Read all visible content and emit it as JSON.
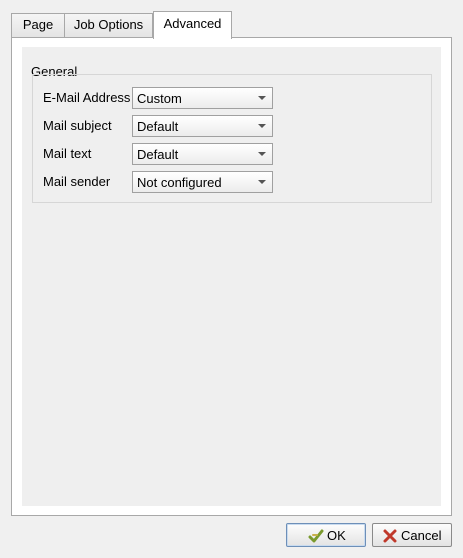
{
  "tabs": [
    {
      "label": "Page",
      "active": false
    },
    {
      "label": "Job Options",
      "active": false
    },
    {
      "label": "Advanced",
      "active": true
    }
  ],
  "group": {
    "title": "General",
    "rows": [
      {
        "label": "E-Mail Address",
        "value": "Custom"
      },
      {
        "label": "Mail subject",
        "value": "Default"
      },
      {
        "label": "Mail text",
        "value": "Default"
      },
      {
        "label": "Mail sender",
        "value": "Not configured"
      }
    ]
  },
  "buttons": {
    "ok_label": "OK",
    "ok_icon": "checkmark-arrow-icon",
    "cancel_label": "Cancel",
    "cancel_icon": "cross-icon"
  },
  "colors": {
    "ok_icon": "#7a9a2e",
    "cancel_icon": "#c0392b"
  }
}
